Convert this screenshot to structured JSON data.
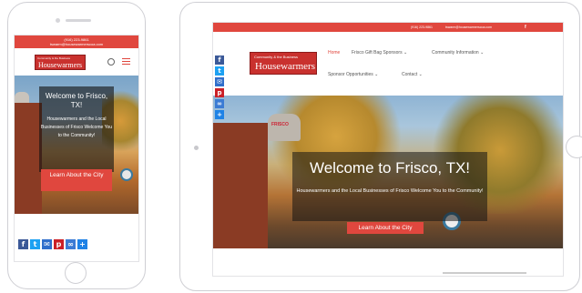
{
  "site": {
    "phone": "(916) 223-9861",
    "email": "tswarm@housewarmerscoa.com",
    "logo_small": "Community & the Business",
    "logo_main": "Housewarmers",
    "nav": [
      {
        "label": "Home"
      },
      {
        "label": "Frisco Gift Bag Sponsors ⌄"
      },
      {
        "label": "Community Information ⌄"
      },
      {
        "label": "Sponsor Opportunities ⌄"
      },
      {
        "label": "Contact ⌄"
      }
    ]
  },
  "hero": {
    "title": "Welcome to Frisco, TX!",
    "subtitle": "Housewarmers and the Local Businesses of Frisco Welcome You to the Community!",
    "cta": "Learn About the City",
    "landmark_label": "FRISCO"
  },
  "share_icons": [
    "facebook-icon",
    "twitter-icon",
    "email-icon",
    "pinterest-icon",
    "link-icon",
    "plus-icon"
  ],
  "colors": {
    "brand_red": "#e0473e",
    "facebook": "#3b5998",
    "twitter": "#1da1f2",
    "pinterest": "#cb2027"
  }
}
